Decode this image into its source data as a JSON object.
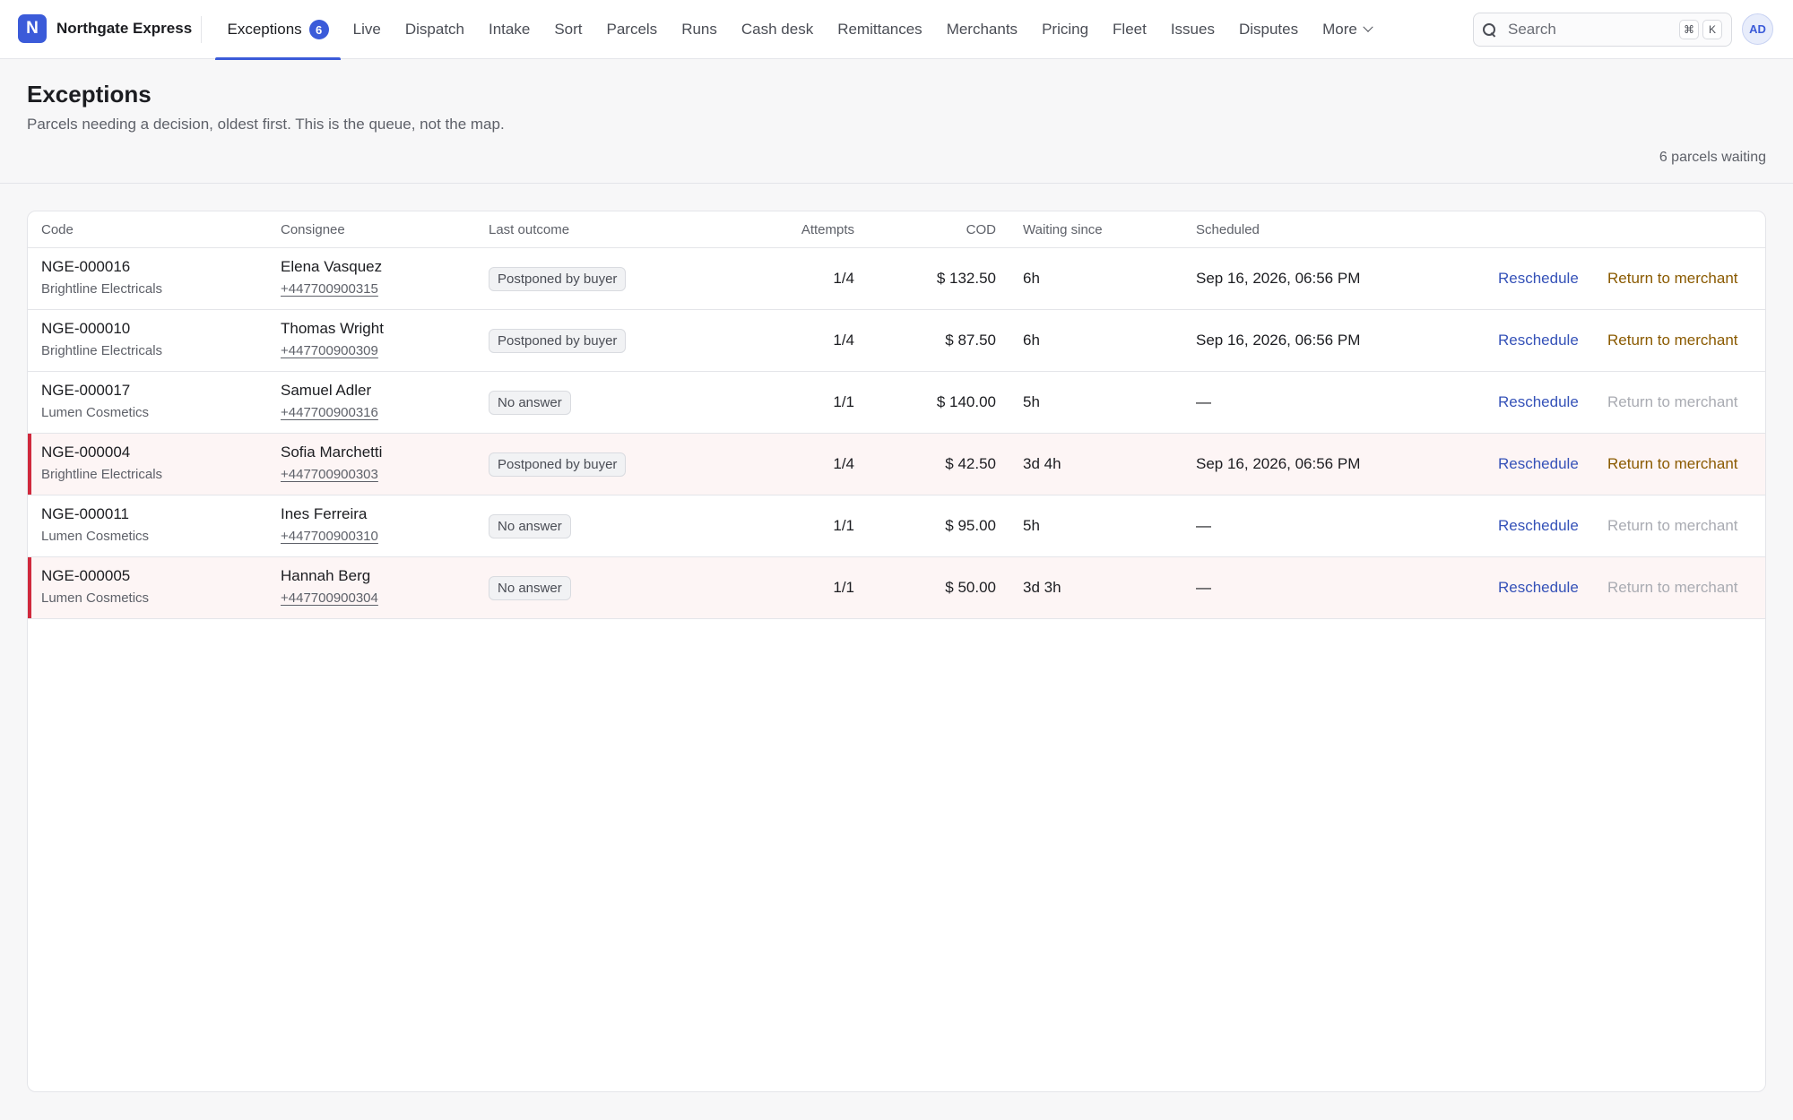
{
  "app": {
    "logo_letter": "N",
    "name": "Northgate Express"
  },
  "nav": {
    "items": [
      {
        "label": "Exceptions",
        "badge": "6",
        "active": true
      },
      {
        "label": "Live"
      },
      {
        "label": "Dispatch"
      },
      {
        "label": "Intake"
      },
      {
        "label": "Sort"
      },
      {
        "label": "Parcels"
      },
      {
        "label": "Runs"
      },
      {
        "label": "Cash desk"
      },
      {
        "label": "Remittances"
      },
      {
        "label": "Merchants"
      },
      {
        "label": "Pricing"
      },
      {
        "label": "Fleet"
      },
      {
        "label": "Issues"
      },
      {
        "label": "Disputes"
      }
    ],
    "more_label": "More"
  },
  "search": {
    "placeholder": "Search",
    "shortcut_mod": "⌘",
    "shortcut_key": "K"
  },
  "user": {
    "initials": "AD"
  },
  "page": {
    "title": "Exceptions",
    "subtitle": "Parcels needing a decision, oldest first. This is the queue, not the map.",
    "waiting_count": "6 parcels waiting"
  },
  "table": {
    "columns": {
      "code": "Code",
      "consignee": "Consignee",
      "outcome": "Last outcome",
      "attempts": "Attempts",
      "cod": "COD",
      "waiting": "Waiting since",
      "scheduled": "Scheduled"
    },
    "reschedule_label": "Reschedule",
    "return_label": "Return to merchant",
    "rows": [
      {
        "code": "NGE-000016",
        "merchant": "Brightline Electricals",
        "consignee": "Elena Vasquez",
        "phone": "+447700900315",
        "outcome": "Postponed by buyer",
        "attempts": "1/4",
        "cod": "$ 132.50",
        "waiting": "6h",
        "scheduled": "Sep 16, 2026, 06:56 PM",
        "urgent": false,
        "return_enabled": true
      },
      {
        "code": "NGE-000010",
        "merchant": "Brightline Electricals",
        "consignee": "Thomas Wright",
        "phone": "+447700900309",
        "outcome": "Postponed by buyer",
        "attempts": "1/4",
        "cod": "$ 87.50",
        "waiting": "6h",
        "scheduled": "Sep 16, 2026, 06:56 PM",
        "urgent": false,
        "return_enabled": true
      },
      {
        "code": "NGE-000017",
        "merchant": "Lumen Cosmetics",
        "consignee": "Samuel Adler",
        "phone": "+447700900316",
        "outcome": "No answer",
        "attempts": "1/1",
        "cod": "$ 140.00",
        "waiting": "5h",
        "scheduled": "—",
        "urgent": false,
        "return_enabled": false
      },
      {
        "code": "NGE-000004",
        "merchant": "Brightline Electricals",
        "consignee": "Sofia Marchetti",
        "phone": "+447700900303",
        "outcome": "Postponed by buyer",
        "attempts": "1/4",
        "cod": "$ 42.50",
        "waiting": "3d 4h",
        "scheduled": "Sep 16, 2026, 06:56 PM",
        "urgent": true,
        "return_enabled": true
      },
      {
        "code": "NGE-000011",
        "merchant": "Lumen Cosmetics",
        "consignee": "Ines Ferreira",
        "phone": "+447700900310",
        "outcome": "No answer",
        "attempts": "1/1",
        "cod": "$ 95.00",
        "waiting": "5h",
        "scheduled": "—",
        "urgent": false,
        "return_enabled": false
      },
      {
        "code": "NGE-000005",
        "merchant": "Lumen Cosmetics",
        "consignee": "Hannah Berg",
        "phone": "+447700900304",
        "outcome": "No answer",
        "attempts": "1/1",
        "cod": "$ 50.00",
        "waiting": "3d 3h",
        "scheduled": "—",
        "urgent": true,
        "return_enabled": false
      }
    ]
  },
  "colors": {
    "accent": "#3b5bd9",
    "urgent": "#d0293d",
    "return_action": "#8a5a00",
    "link": "#3552b8"
  }
}
